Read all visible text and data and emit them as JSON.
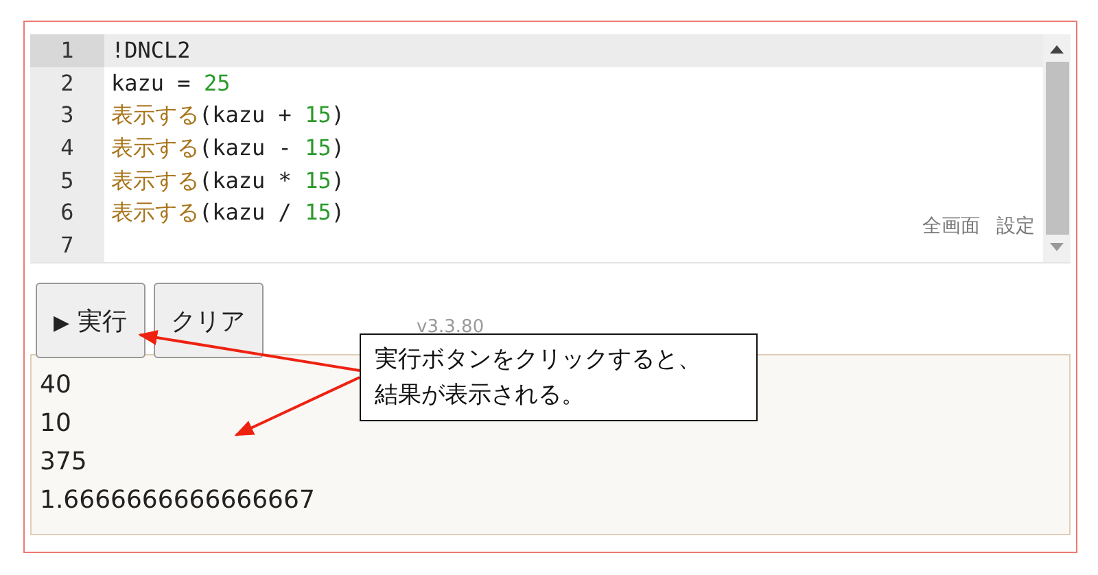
{
  "editor": {
    "lines": [
      {
        "number": "1",
        "active": true,
        "tokens": [
          {
            "kind": "plain",
            "text": "!DNCL2"
          }
        ]
      },
      {
        "number": "2",
        "active": false,
        "tokens": [
          {
            "kind": "plain",
            "text": "kazu = "
          },
          {
            "kind": "num",
            "text": "25"
          }
        ]
      },
      {
        "number": "3",
        "active": false,
        "tokens": [
          {
            "kind": "func",
            "text": "表示する"
          },
          {
            "kind": "plain",
            "text": "(kazu + "
          },
          {
            "kind": "num",
            "text": "15"
          },
          {
            "kind": "plain",
            "text": ")"
          }
        ]
      },
      {
        "number": "4",
        "active": false,
        "tokens": [
          {
            "kind": "func",
            "text": "表示する"
          },
          {
            "kind": "plain",
            "text": "(kazu - "
          },
          {
            "kind": "num",
            "text": "15"
          },
          {
            "kind": "plain",
            "text": ")"
          }
        ]
      },
      {
        "number": "5",
        "active": false,
        "tokens": [
          {
            "kind": "func",
            "text": "表示する"
          },
          {
            "kind": "plain",
            "text": "(kazu * "
          },
          {
            "kind": "num",
            "text": "15"
          },
          {
            "kind": "plain",
            "text": ")"
          }
        ]
      },
      {
        "number": "6",
        "active": false,
        "tokens": [
          {
            "kind": "func",
            "text": "表示する"
          },
          {
            "kind": "plain",
            "text": "(kazu / "
          },
          {
            "kind": "num",
            "text": "15"
          },
          {
            "kind": "plain",
            "text": ")"
          }
        ]
      },
      {
        "number": "7",
        "active": false
      }
    ],
    "links": [
      "全画面",
      "設定"
    ]
  },
  "buttons": [
    {
      "icon": "▶",
      "label": "実行"
    },
    {
      "label": "クリア"
    }
  ],
  "version": "v3.3.80",
  "output": [
    "40",
    "10",
    "375",
    "1.6666666666666667"
  ],
  "callout": {
    "lines": [
      "実行ボタンをクリックすると、",
      "結果が表示される。"
    ]
  }
}
